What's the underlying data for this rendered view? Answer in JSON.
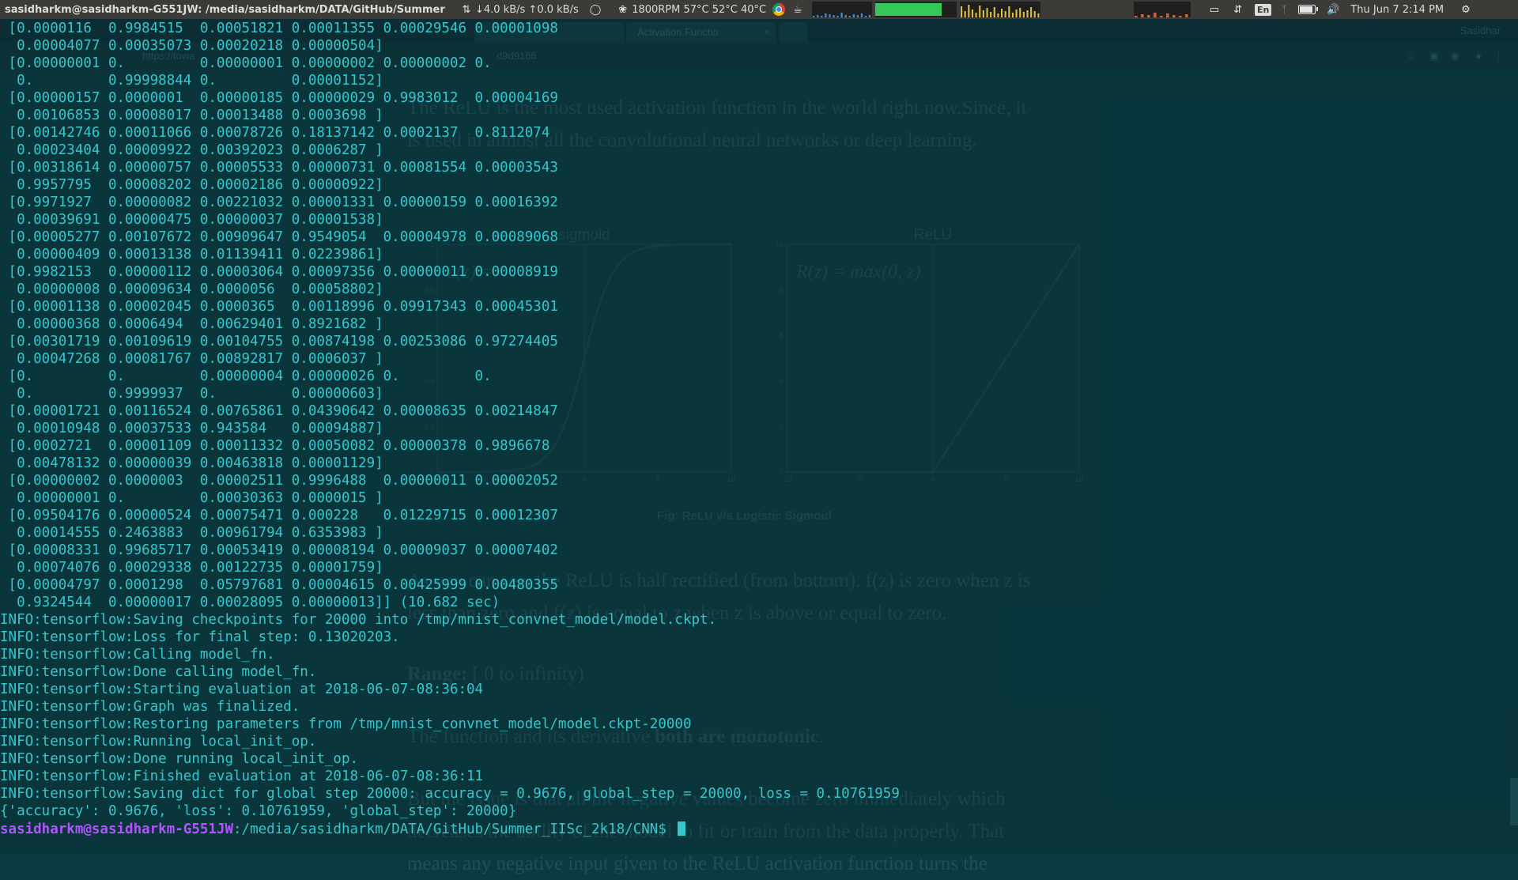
{
  "panel": {
    "window_title": "sasidharkm@sasidharkm-G551JW: /media/sasidharkm/DATA/GitHub/Summer",
    "net_speed": "↓4.0 kB/s ↑0.0 kB/s",
    "sensors": "1800RPM 57°C 52°C 40°C",
    "keyboard_layout": "En",
    "clock": "Thu Jun 7  2:14 PM",
    "cpu_graph_heights": [
      2,
      3,
      2,
      5,
      4,
      3,
      2,
      6,
      3,
      2,
      4,
      3,
      5,
      2,
      3
    ],
    "memory_fill": 0.82,
    "load_graph_heights": [
      14,
      8,
      16,
      10,
      6,
      15,
      9,
      12,
      7,
      13,
      5,
      11,
      8,
      14,
      6,
      10,
      12,
      7,
      9,
      13,
      8,
      5
    ],
    "disk_graph_heights": [
      2,
      4,
      3,
      6,
      2,
      5,
      3,
      2,
      4
    ]
  },
  "browser": {
    "tab_title": "Activation Functio",
    "profile": "Sasidhar",
    "url": "https://towa",
    "url_tail": "d9d9166",
    "article": {
      "p1a": "The ReLU is the most used activation function in the world right now.Since, it",
      "p1b": "is used in almost all the convolutional neural networks or deep learning.",
      "sigmoid_title": "sigmoid",
      "relu_title": "ReLU",
      "sigmoid_formula": "σ(z) = 1/(1+e^-z)",
      "sigmoid_formula_display": "σ(z) = ",
      "relu_formula": "R(z) = max(0, z)",
      "caption": "Fig: ReLU v/s Logistic Sigmoid",
      "p2a": "As you can see, the ReLU is half rectified (from bottom). f(z) is zero when z is",
      "p2b": "less than zero and f(z) is equal to z when z is above or equal to zero.",
      "range_label": "Range:",
      "range_value": " [ 0 to infinity)",
      "p3a": "The function and its derivative ",
      "p3b": "both are monotonic",
      "p3c": ".",
      "p4a": "But the issue is that all the negative values become zero immediately which",
      "p4b": "decreases the ability of the model to fit or train from the data properly. That",
      "p4c": "means any negative input given to the ReLU activation function turns the"
    },
    "charts": [
      {
        "name": "sigmoid",
        "x_ticks": [
          -10,
          -5,
          0,
          5,
          10
        ],
        "y_ticks": [
          0.0,
          0.2,
          0.4,
          0.6,
          0.8,
          1.0
        ],
        "xlim": [
          -10,
          10
        ],
        "ylim": [
          0,
          1
        ]
      },
      {
        "name": "relu",
        "x_ticks": [
          -10,
          -5,
          0,
          5,
          10
        ],
        "y_ticks": [
          0,
          2,
          4,
          6,
          8,
          10
        ],
        "xlim": [
          -10,
          10
        ],
        "ylim": [
          0,
          10
        ]
      }
    ]
  },
  "terminal": {
    "lines": [
      " [0.0000116  0.9984515  0.00051821 0.00011355 0.00029546 0.00001098",
      "  0.00004077 0.00035073 0.00020218 0.00000504]",
      " [0.00000001 0.         0.00000001 0.00000002 0.00000002 0.",
      "  0.         0.99998844 0.         0.00001152]",
      " [0.00000157 0.0000001  0.00000185 0.00000029 0.9983012  0.00004169",
      "  0.00106853 0.00008017 0.00013488 0.0003698 ]",
      " [0.00142746 0.00011066 0.00078726 0.18137142 0.0002137  0.8112074",
      "  0.00023404 0.00009922 0.00392023 0.0006287 ]",
      " [0.00318614 0.00000757 0.00005533 0.00000731 0.00081554 0.00003543",
      "  0.9957795  0.00008202 0.00002186 0.00000922]",
      " [0.9971927  0.00000082 0.00221032 0.00001331 0.00000159 0.00016392",
      "  0.00039691 0.00000475 0.00000037 0.00001538]",
      " [0.00005277 0.00107672 0.00909647 0.9549054  0.00004978 0.00089068",
      "  0.00000409 0.00013138 0.01139411 0.02239861]",
      " [0.9982153  0.00000112 0.00003064 0.00097356 0.00000011 0.00008919",
      "  0.00000008 0.00009634 0.0000056  0.00058802]",
      " [0.00001138 0.00002045 0.0000365  0.00118996 0.09917343 0.00045301",
      "  0.00000368 0.0006494  0.00629401 0.8921682 ]",
      " [0.00301719 0.00109619 0.00104755 0.00874198 0.00253086 0.97274405",
      "  0.00047268 0.00081767 0.00892817 0.0006037 ]",
      " [0.         0.         0.00000004 0.00000026 0.         0.",
      "  0.         0.9999937  0.         0.00000603]",
      " [0.00001721 0.00116524 0.00765861 0.04390642 0.00008635 0.00214847",
      "  0.00010948 0.00037533 0.943584   0.00094887]",
      " [0.0002721  0.00001109 0.00011332 0.00050082 0.00000378 0.9896678",
      "  0.00478132 0.00000039 0.00463818 0.00001129]",
      " [0.00000002 0.0000003  0.00002511 0.9996488  0.00000011 0.00002052",
      "  0.00000001 0.         0.00030363 0.0000015 ]",
      " [0.09504176 0.00000524 0.00075471 0.000228   0.01229715 0.00012307",
      "  0.00014555 0.2463883  0.00961794 0.6353983 ]",
      " [0.00008331 0.99685717 0.00053419 0.00008194 0.00009037 0.00007402",
      "  0.00074076 0.00029338 0.00122735 0.00001759]",
      " [0.00004797 0.0001298  0.05797681 0.00004615 0.00425999 0.00480355",
      "  0.9324544  0.00000017 0.00028095 0.00000013]] (10.682 sec)",
      "INFO:tensorflow:Saving checkpoints for 20000 into /tmp/mnist_convnet_model/model.ckpt.",
      "INFO:tensorflow:Loss for final step: 0.13020203.",
      "INFO:tensorflow:Calling model_fn.",
      "INFO:tensorflow:Done calling model_fn.",
      "INFO:tensorflow:Starting evaluation at 2018-06-07-08:36:04",
      "INFO:tensorflow:Graph was finalized.",
      "INFO:tensorflow:Restoring parameters from /tmp/mnist_convnet_model/model.ckpt-20000",
      "INFO:tensorflow:Running local_init_op.",
      "INFO:tensorflow:Done running local_init_op.",
      "INFO:tensorflow:Finished evaluation at 2018-06-07-08:36:11",
      "INFO:tensorflow:Saving dict for global step 20000: accuracy = 0.9676, global_step = 20000, loss = 0.10761959",
      "{'accuracy': 0.9676, 'loss': 0.10761959, 'global_step': 20000}"
    ],
    "prompt_user": "sasidharkm@sasidharkm-G551JW",
    "prompt_path": ":/media/sasidharkm/DATA/GitHub/Summer_IISc_2k18/CNN$ ",
    "colors": {
      "text": "#36c7ce",
      "user": "#b254ff",
      "background": "#0b3a40"
    }
  }
}
